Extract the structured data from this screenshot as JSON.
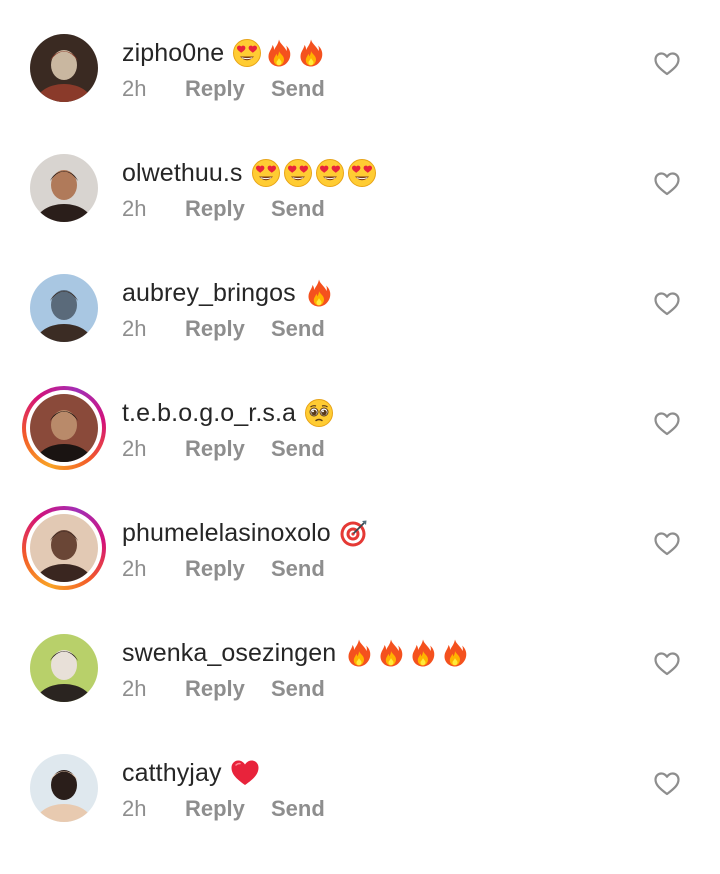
{
  "comments": [
    {
      "username": "zipho0ne",
      "emojis": [
        "heart-eyes",
        "fire",
        "fire"
      ],
      "time": "2h",
      "reply_label": "Reply",
      "send_label": "Send",
      "story_ring": false,
      "avatar_colors": [
        "#3a2a22",
        "#8a3a2a",
        "#c9b7a0"
      ]
    },
    {
      "username": "olwethuu.s",
      "emojis": [
        "heart-eyes",
        "heart-eyes",
        "heart-eyes",
        "heart-eyes"
      ],
      "time": "2h",
      "reply_label": "Reply",
      "send_label": "Send",
      "story_ring": false,
      "avatar_colors": [
        "#d8d4d0",
        "#2a1e1a",
        "#b07a5a"
      ]
    },
    {
      "username": "aubrey_bringos",
      "emojis": [
        "fire"
      ],
      "time": "2h",
      "reply_label": "Reply",
      "send_label": "Send",
      "story_ring": false,
      "avatar_colors": [
        "#a9c7e2",
        "#3b2c24",
        "#5a6a7a"
      ]
    },
    {
      "username": "t.e.b.o.g.o_r.s.a",
      "emojis": [
        "pleading"
      ],
      "time": "2h",
      "reply_label": "Reply",
      "send_label": "Send",
      "story_ring": true,
      "avatar_colors": [
        "#8a4a3a",
        "#1a1412",
        "#b98a6a"
      ]
    },
    {
      "username": "phumelelasinoxolo",
      "emojis": [
        "target"
      ],
      "time": "2h",
      "reply_label": "Reply",
      "send_label": "Send",
      "story_ring": true,
      "avatar_colors": [
        "#e2c9b4",
        "#3a2620",
        "#6a4636"
      ]
    },
    {
      "username": "swenka_osezingen",
      "emojis": [
        "fire",
        "fire",
        "fire",
        "fire"
      ],
      "time": "2h",
      "reply_label": "Reply",
      "send_label": "Send",
      "story_ring": false,
      "avatar_colors": [
        "#b8d06a",
        "#2a2420",
        "#e8e0d8"
      ]
    },
    {
      "username": "catthyjay",
      "emojis": [
        "red-heart"
      ],
      "time": "2h",
      "reply_label": "Reply",
      "send_label": "Send",
      "story_ring": false,
      "avatar_colors": [
        "#dfe8ee",
        "#e8cab0",
        "#2a1e1a"
      ]
    }
  ],
  "like_icon": "heart-outline-icon",
  "colors": {
    "text_primary": "#262626",
    "text_secondary": "#8e8e8e",
    "background": "#ffffff"
  }
}
